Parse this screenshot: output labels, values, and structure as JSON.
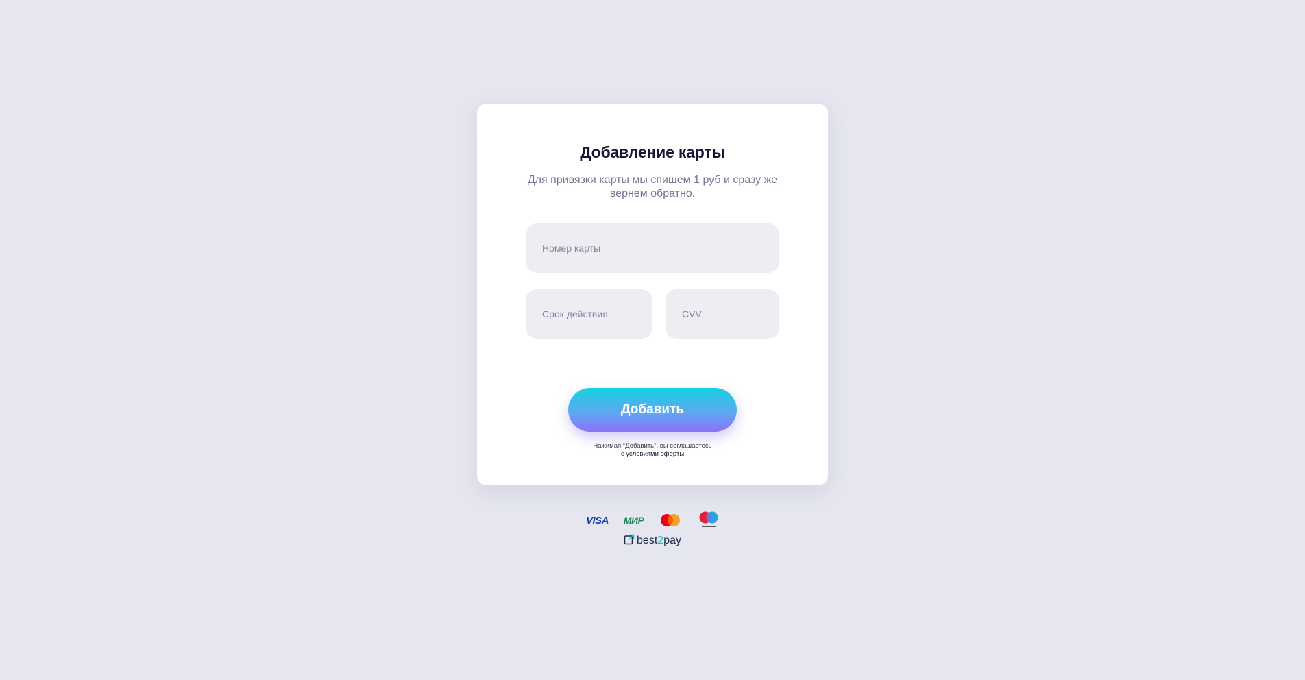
{
  "form": {
    "title": "Добавление карты",
    "subtitle": "Для привязки карты мы спишем 1 руб и сразу же вернем обратно.",
    "card_number_placeholder": "Номер карты",
    "expiry_placeholder": "Срок действия",
    "cvv_placeholder": "CVV",
    "submit_label": "Добавить",
    "agreement_prefix": "Нажимая \"Добавить\", вы соглашаетесь",
    "agreement_connector": "с",
    "agreement_link": "условиями оферты"
  },
  "footer": {
    "payment_logos": [
      "visa-logo",
      "mir-logo",
      "mastercard-logo",
      "maestro-logo"
    ],
    "visa_text": "VISA",
    "mir_text": "МИР",
    "brand_prefix": "best",
    "brand_two": "2",
    "brand_suffix": "pay"
  },
  "colors": {
    "background": "#e5e6ef",
    "card": "#ffffff",
    "input_bg": "#eeedf2",
    "button_gradient_top": "#14d2e0",
    "button_gradient_bottom": "#8a72f6",
    "title": "#1d1536",
    "subtitle": "#7e6f96"
  }
}
